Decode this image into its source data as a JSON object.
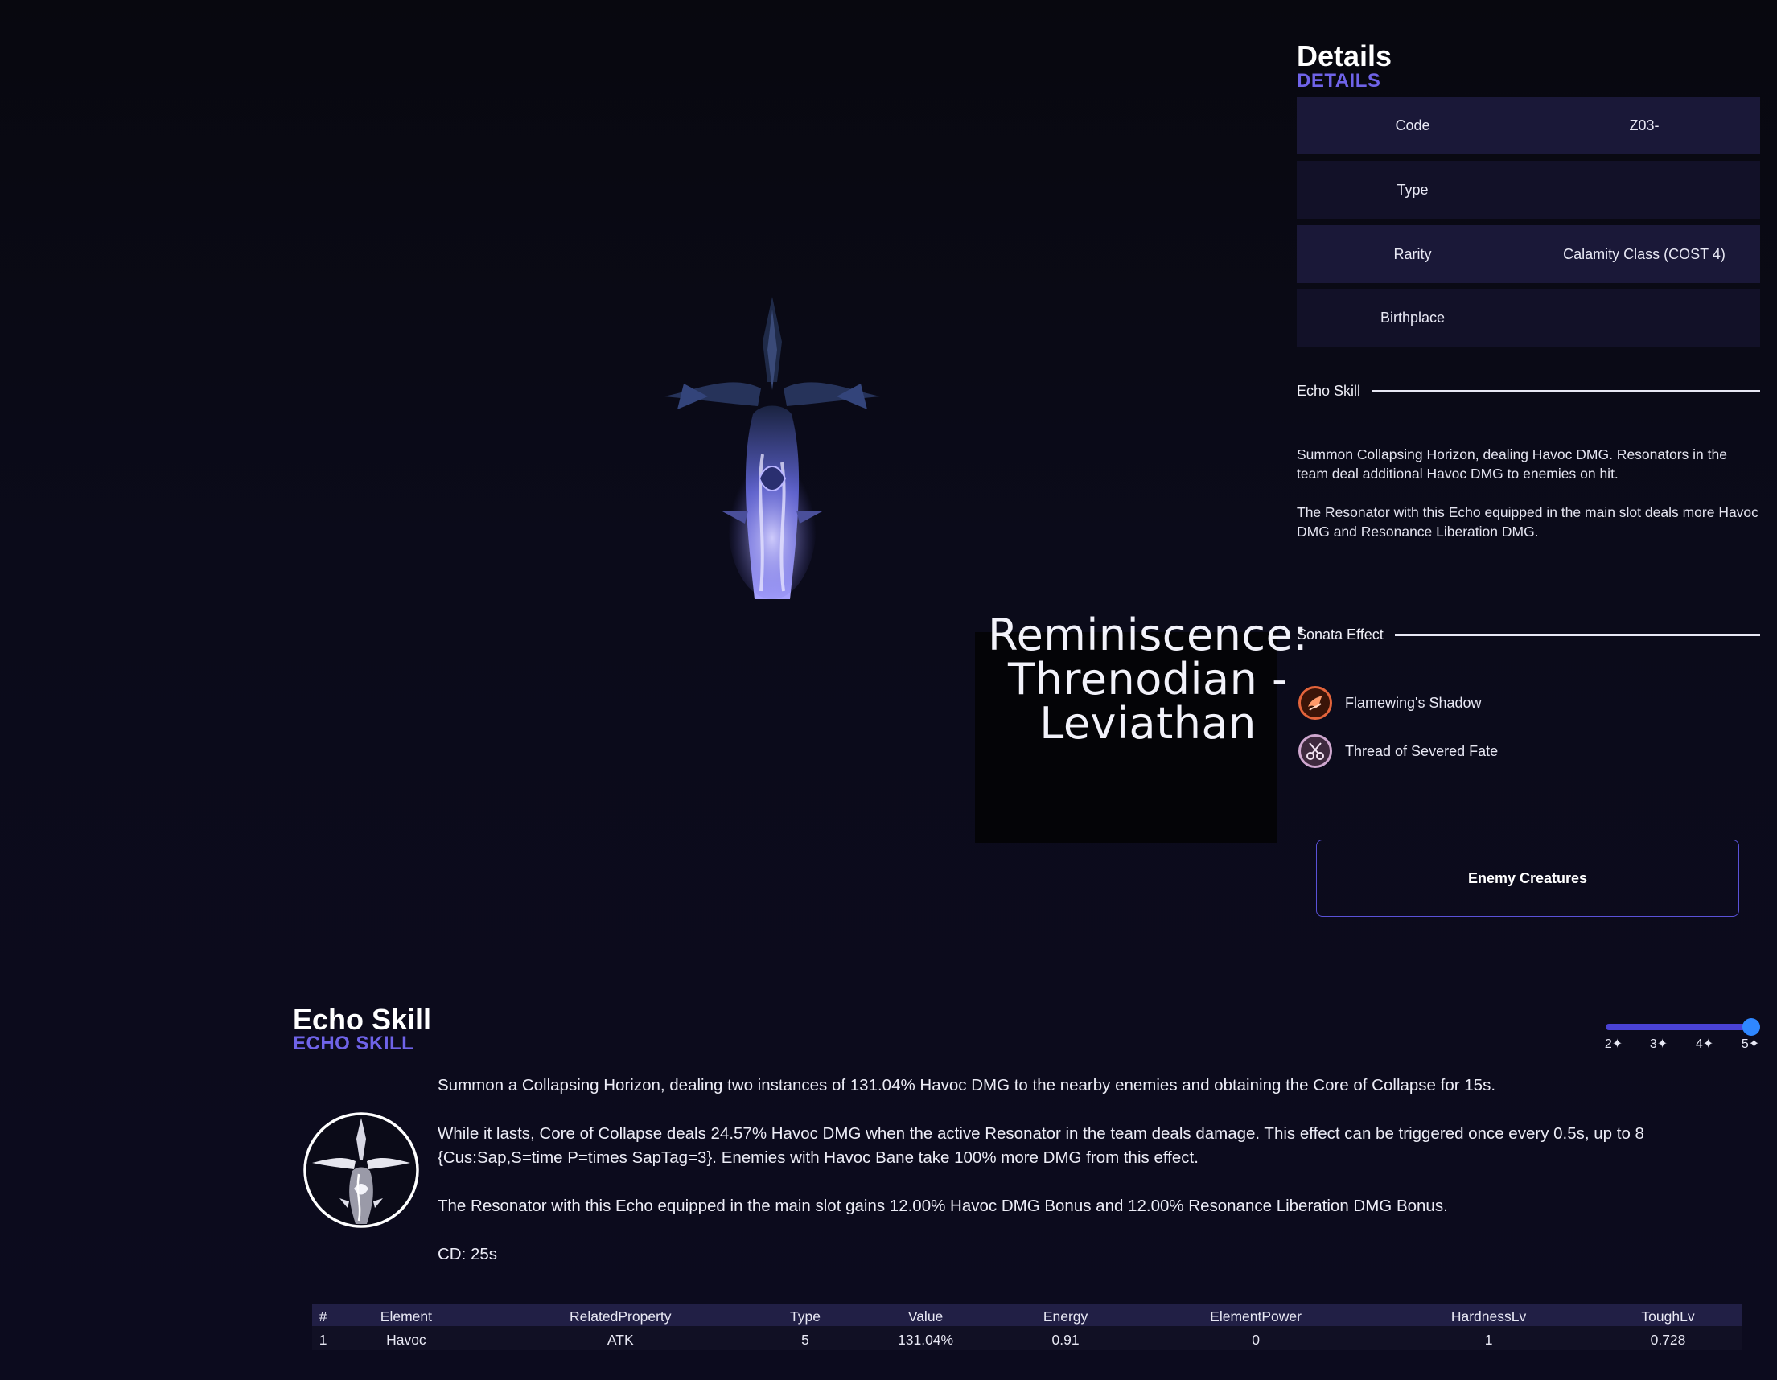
{
  "echo": {
    "title_lines": [
      "Reminiscence:",
      "Threnodian -",
      "Leviathan"
    ]
  },
  "details": {
    "title": "Details",
    "subtitle": "DETAILS",
    "rows": [
      {
        "key": "Code",
        "value": "Z03-"
      },
      {
        "key": "Type",
        "value": ""
      },
      {
        "key": "Rarity",
        "value": "Calamity Class (COST 4)"
      },
      {
        "key": "Birthplace",
        "value": ""
      }
    ],
    "echo_skill_label": "Echo Skill",
    "echo_skill_desc": [
      "Summon Collapsing Horizon, dealing Havoc DMG. Resonators in the team deal additional Havoc DMG to enemies on hit.",
      "The Resonator with this Echo equipped in the main slot deals more Havoc DMG and Resonance Liberation DMG."
    ],
    "sonata_label": "Sonata Effect",
    "sonata_sets": [
      {
        "name": "Flamewing's Shadow",
        "icon": "flamewing-icon",
        "color": "#e3643b"
      },
      {
        "name": "Thread of Severed Fate",
        "icon": "scissors-icon",
        "color": "#cfa7cf"
      }
    ],
    "enemy_button": "Enemy Creatures"
  },
  "skill": {
    "title": "Echo Skill",
    "subtitle": "ECHO SKILL",
    "rank_ticks": [
      "2✦",
      "3✦",
      "4✦",
      "5✦"
    ],
    "rank_selected": "5✦",
    "paragraphs": [
      "Summon a Collapsing Horizon, dealing two instances of 131.04% Havoc DMG to the nearby enemies and obtaining the Core of Collapse for 15s.",
      "While it lasts, Core of Collapse deals 24.57% Havoc DMG when the active Resonator in the team deals damage. This effect can be triggered once every 0.5s, up to 8 {Cus:Sap,S=time P=times SapTag=3}. Enemies with Havoc Bane take 100% more DMG from this effect.",
      "The Resonator with this Echo equipped in the main slot gains 12.00% Havoc DMG Bonus and 12.00% Resonance Liberation DMG Bonus.",
      "CD: 25s"
    ],
    "table": {
      "headers": [
        "#",
        "Element",
        "RelatedProperty",
        "Type",
        "Value",
        "Energy",
        "ElementPower",
        "HardnessLv",
        "ToughLv"
      ],
      "rows": [
        [
          "1",
          "Havoc",
          "ATK",
          "5",
          "131.04%",
          "0.91",
          "0",
          "1",
          "0.728"
        ]
      ]
    }
  },
  "colors": {
    "accent": "#6f63e8",
    "background": "#0a0a16",
    "row_odd": "#1a1838",
    "row_even": "#121128"
  }
}
